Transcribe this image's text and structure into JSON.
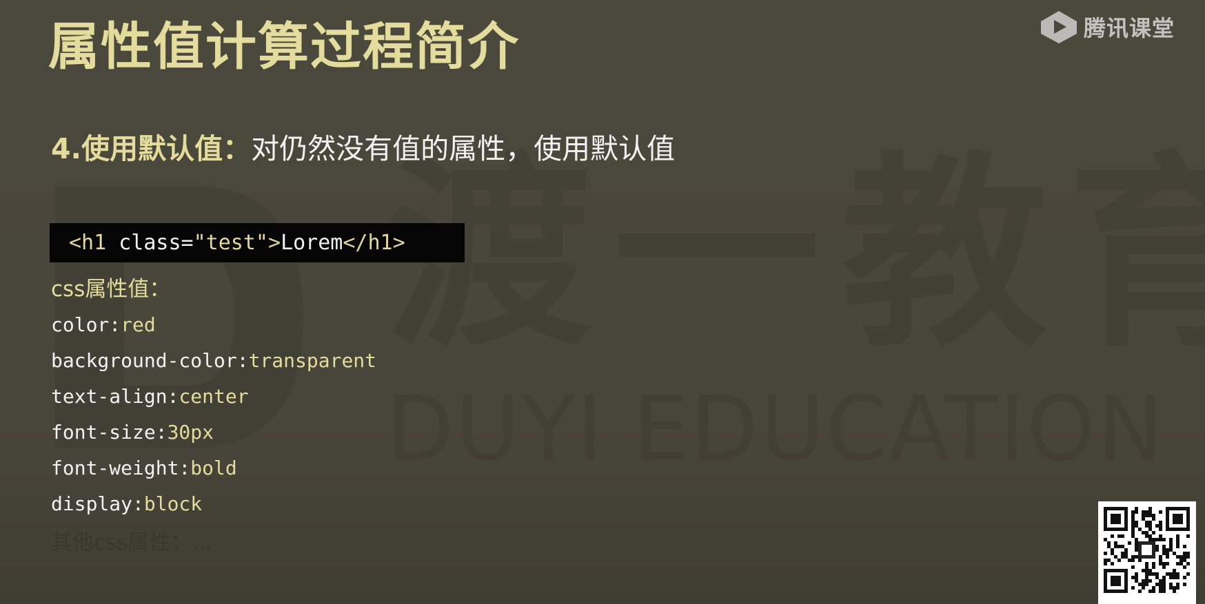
{
  "slide": {
    "title": "属性值计算过程简介",
    "brand": {
      "text": "腾讯课堂",
      "icon": "tencent-classroom-logo-icon"
    },
    "watermark": {
      "cn": "渡一教育",
      "en": "DUYI EDUCATION"
    },
    "step": {
      "label": "4.使用默认值：",
      "text": "对仍然没有值的属性，使用默认值"
    },
    "code": {
      "open_tag": "<h1",
      "attr": "class=",
      "value": "\"test\"",
      "close_open": ">",
      "content": "Lorem",
      "close_tag": "</h1>"
    },
    "props_heading": "css属性值：",
    "props": [
      {
        "name": "color:",
        "value": "red"
      },
      {
        "name": "background-color:",
        "value": "transparent"
      },
      {
        "name": "text-align:",
        "value": "center"
      },
      {
        "name": "font-size:",
        "value": "30px"
      },
      {
        "name": "font-weight:",
        "value": "bold"
      },
      {
        "name": "display:",
        "value": "block"
      }
    ],
    "props_other": "其他css属性：...",
    "qr_icon": "qr-code-icon",
    "colors": {
      "background": "#4a473b",
      "accent": "#e3dc9c",
      "text": "#f2f2f2",
      "code_bg": "#050505"
    }
  }
}
